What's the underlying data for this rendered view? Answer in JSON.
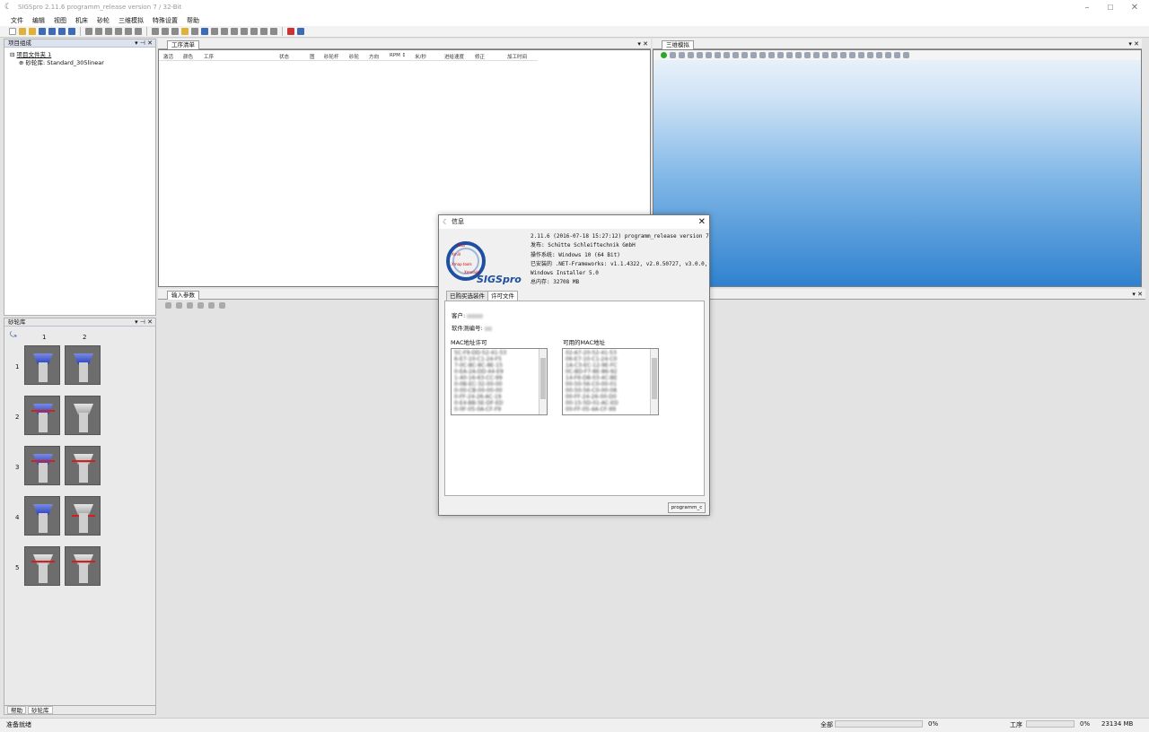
{
  "window": {
    "title": "SIGSpro 2.11.6 programm_release version 7 / 32-Bit",
    "min": "–",
    "max": "☐",
    "close": "✕"
  },
  "menu": [
    "文件",
    "编辑",
    "视图",
    "机床",
    "砂轮",
    "三维模拟",
    "特殊设置",
    "帮助"
  ],
  "project_panel": {
    "title": "项目组成",
    "pin": "▾ ⊣ ✕",
    "tree": [
      "项目文件夹 1",
      "砂轮库: Standard_305linear"
    ]
  },
  "ops_panel": {
    "tab": "工序清单",
    "ctl": "▾ ✕",
    "columns": [
      "激活",
      "颜色",
      "工序",
      "状态",
      "图",
      "砂轮杆",
      "砂轮",
      "方向",
      "RPM ↕",
      "米/秒",
      "进给速度",
      "修正",
      "加工时间"
    ]
  },
  "sim_panel": {
    "tab": "三维模拟",
    "ctl": "▾ ✕"
  },
  "input_panel": {
    "tab": "输入参数",
    "ctl": "▾ ✕"
  },
  "wheel_panel": {
    "title": "砂轮库",
    "pin": "▾ ⊣ ✕",
    "cols": [
      "1",
      "2"
    ],
    "rows": [
      "1",
      "2",
      "3",
      "4",
      "5"
    ],
    "tabs": [
      "帮助",
      "砂轮库"
    ]
  },
  "status": {
    "left": "准备就绪",
    "all_label": "全部",
    "all_pct": "0%",
    "op_label": "工序",
    "op_pct": "0%",
    "mem": "23134 MB"
  },
  "dialog": {
    "title": "信息",
    "close": "✕",
    "logo": {
      "line1": "Xcut",
      "line2": "Xmill",
      "line3": "Xmap tools",
      "line4": "Xmodule",
      "brand": "SIGSpro"
    },
    "info": [
      "2.11.6  (2016-07-18 15:27:12) programm_release version 7 (32",
      "发布: Schütte Schleiftechnik GmbH",
      "操作系统: Windows 10 (64 Bit)",
      "已安装的 .NET-Frameworks: v1.1.4322, v2.0.50727, v3.0.0, v3.",
      "Windows Installer 5.0",
      "总内存: 32708 MB"
    ],
    "tabs": [
      "已购买选装件",
      "许可文件"
    ],
    "customer_label": "客户:",
    "serial_label": "软件测编号:",
    "mac_license_label": "MAC地址许可",
    "mac_available_label": "可用的MAC地址",
    "mac_license_list": [
      "5C-F9-DD-52-41-53",
      "6-E7-10-C1-24-F5",
      "7-0C-BC-8C-8E-15",
      "0-EA-2A-DD-44-E9",
      "1-40-16-63-CC-99",
      "0-0B-EC-32-00-00",
      "0-00-CB-00-00-00",
      "0-FF-24-26-AC-19",
      "0-E4-BB-5E-DF-ED",
      "0-0F-05-0A-CF-F9"
    ],
    "mac_available_list": [
      "02-A7-20-52-41-53",
      "06-E7-10-C1-24-C0",
      "1A-C3-EC-12-9E-FC",
      "0C-BD-F7-8E-86-92",
      "14-F6-D8-03-4C-BE",
      "00-50-56-C0-00-01",
      "00-50-56-C0-00-08",
      "00-FF-24-26-00-D0",
      "00-15-5D-01-AC-ED",
      "00-FF-05-4A-CF-99"
    ],
    "button": "programm_c"
  }
}
